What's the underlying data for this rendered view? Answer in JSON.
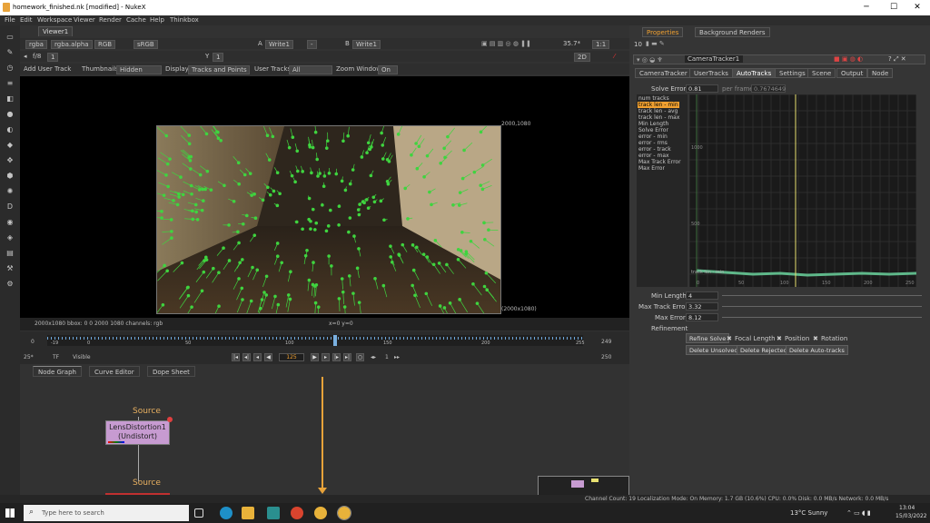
{
  "window": {
    "title": "homework_finished.nk [modified] - NukeX",
    "minimize": "─",
    "maximize": "☐",
    "close": "✕"
  },
  "menu": [
    "File",
    "Edit",
    "Workspace",
    "Viewer",
    "Render",
    "Cache",
    "Help",
    "Thinkbox"
  ],
  "viewer": {
    "tab": "Viewer1",
    "row1": {
      "channels": "rgba",
      "alpha": "rgba.alpha",
      "colorspace_short": "RGB",
      "colorspace": "sRGB",
      "a_label": "A",
      "a_input": "Write1",
      "dash": "-",
      "b_label": "B",
      "b_input": "Write1",
      "zoom": "35.7*",
      "ratio": "1:1"
    },
    "row2": {
      "fstop": "f/8",
      "frame_step": "1",
      "y_label": "Y",
      "y_value": "1",
      "view_mode": "2D"
    },
    "row3": {
      "add_user_track": "Add User Track",
      "thumbnails_label": "Thumbnails",
      "thumbnails_value": "Hidden",
      "display_label": "Display",
      "display_value": "Tracks and Points",
      "usertracks_label": "User Tracks",
      "usertracks_value": "All",
      "zoomwin_label": "Zoom Window",
      "zoomwin_value": "On"
    },
    "corner_top": "2000,1080",
    "corner_bottom": "(2000x1080)",
    "info": "2000x1080  bbox: 0 0 2000 1080 channels: rgb",
    "coords": "x=0 y=0"
  },
  "timeline": {
    "start": "0",
    "start_marker": "-19",
    "ticks": [
      "0",
      "50",
      "100",
      "150",
      "200"
    ],
    "end_marker": "255",
    "end": "249",
    "end2": "250",
    "fps": "25*",
    "tf": "TF",
    "visible": "Visible",
    "current_frame": "125",
    "step": "1",
    "playhead": "125"
  },
  "nodegraph": {
    "tabs": [
      "Node Graph",
      "Curve Editor",
      "Dope Sheet"
    ],
    "node_label": "LensDistortion1",
    "node_sub": "(Undistort)",
    "input1": "Source",
    "input2": "Source"
  },
  "properties": {
    "tabs": [
      "Properties",
      "Background Renders"
    ],
    "num": "10",
    "node_name": "CameraTracker1",
    "subtabs": [
      "CameraTracker",
      "UserTracks",
      "AutoTracks",
      "Settings",
      "Scene",
      "Output",
      "Node"
    ],
    "solve_error_label": "Solve Error",
    "solve_error": "0.81",
    "per_frame_label": "per frame",
    "per_frame": "0.7674649",
    "curves": [
      "num tracks",
      "track len - min",
      "track len - avg",
      "track len - max",
      "Min Length",
      "Solve Error",
      "error - min",
      "error - rms",
      "error - track",
      "error - max",
      "Max Track Error",
      "Max Error"
    ],
    "graph_labels": {
      "y1": "1000",
      "y2": "500",
      "curve": "track len - min"
    },
    "graph_x": [
      "0",
      "50",
      "100",
      "150",
      "200",
      "250"
    ],
    "min_length_label": "Min Length",
    "min_length": "4",
    "max_track_error_label": "Max Track Error",
    "max_track_error": "3.32",
    "max_error_label": "Max Error",
    "max_error": "8.12",
    "refinement_label": "Refinement",
    "buttons": {
      "refine": "Refine Solve",
      "focal": "Focal Length",
      "position": "Position",
      "rotation": "Rotation",
      "del_unsolved": "Delete Unsolved",
      "del_rejected": "Delete Rejected",
      "del_auto": "Delete Auto-tracks"
    }
  },
  "statusbar": "Channel Count: 19  Localization Mode: On  Memory: 1.7 GB (10.6%)  CPU: 0.0%  Disk: 0.0 MB/s  Network: 0.0 MB/s",
  "taskbar": {
    "search": "Type here to search",
    "weather": "13°C  Sunny",
    "time": "13:04",
    "date": "15/03/2022"
  },
  "colors": {
    "accent": "#e8a33a",
    "track": "#3fd43f",
    "node": "#c79bd1",
    "selected_tab": "#f0a030"
  }
}
